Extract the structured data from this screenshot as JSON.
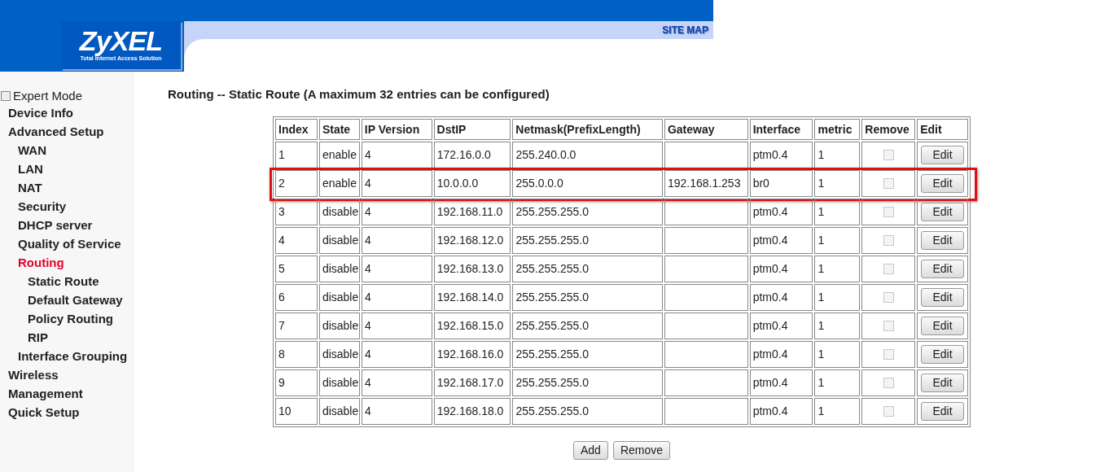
{
  "header": {
    "logo": "ZyXEL",
    "tagline": "Total Internet Access Solution",
    "site_map": "SITE MAP"
  },
  "sidebar": {
    "expert_mode": {
      "label": "Expert Mode",
      "checked": false
    },
    "items": [
      {
        "label": "Device Info",
        "selected": false
      },
      {
        "label": "Advanced Setup",
        "selected": false,
        "children": [
          {
            "label": "WAN",
            "selected": false
          },
          {
            "label": "LAN",
            "selected": false
          },
          {
            "label": "NAT",
            "selected": false
          },
          {
            "label": "Security",
            "selected": false
          },
          {
            "label": "DHCP server",
            "selected": false
          },
          {
            "label": "Quality of Service",
            "selected": false
          },
          {
            "label": "Routing",
            "selected": true,
            "children": [
              {
                "label": "Static Route",
                "selected": false
              },
              {
                "label": "Default Gateway",
                "selected": false
              },
              {
                "label": "Policy Routing",
                "selected": false
              },
              {
                "label": "RIP",
                "selected": false
              }
            ]
          },
          {
            "label": "Interface Grouping",
            "selected": false
          }
        ]
      },
      {
        "label": "Wireless",
        "selected": false
      },
      {
        "label": "Management",
        "selected": false
      },
      {
        "label": "Quick Setup",
        "selected": false
      }
    ]
  },
  "page_title": "Routing -- Static Route (A maximum 32 entries can be configured)",
  "table": {
    "columns": [
      "Index",
      "State",
      "IP Version",
      "DstIP",
      "Netmask(PrefixLength)",
      "Gateway",
      "Interface",
      "metric",
      "Remove",
      "Edit"
    ],
    "rows": [
      {
        "index": "1",
        "state": "enable",
        "ip_version": "4",
        "dst_ip": "172.16.0.0",
        "netmask": "255.240.0.0",
        "gateway": "",
        "interface": "ptm0.4",
        "metric": "1",
        "remove": false,
        "edit": "Edit",
        "highlighted": false
      },
      {
        "index": "2",
        "state": "enable",
        "ip_version": "4",
        "dst_ip": "10.0.0.0",
        "netmask": "255.0.0.0",
        "gateway": "192.168.1.253",
        "interface": "br0",
        "metric": "1",
        "remove": false,
        "edit": "Edit",
        "highlighted": true
      },
      {
        "index": "3",
        "state": "disable",
        "ip_version": "4",
        "dst_ip": "192.168.11.0",
        "netmask": "255.255.255.0",
        "gateway": "",
        "interface": "ptm0.4",
        "metric": "1",
        "remove": false,
        "edit": "Edit",
        "highlighted": false
      },
      {
        "index": "4",
        "state": "disable",
        "ip_version": "4",
        "dst_ip": "192.168.12.0",
        "netmask": "255.255.255.0",
        "gateway": "",
        "interface": "ptm0.4",
        "metric": "1",
        "remove": false,
        "edit": "Edit",
        "highlighted": false
      },
      {
        "index": "5",
        "state": "disable",
        "ip_version": "4",
        "dst_ip": "192.168.13.0",
        "netmask": "255.255.255.0",
        "gateway": "",
        "interface": "ptm0.4",
        "metric": "1",
        "remove": false,
        "edit": "Edit",
        "highlighted": false
      },
      {
        "index": "6",
        "state": "disable",
        "ip_version": "4",
        "dst_ip": "192.168.14.0",
        "netmask": "255.255.255.0",
        "gateway": "",
        "interface": "ptm0.4",
        "metric": "1",
        "remove": false,
        "edit": "Edit",
        "highlighted": false
      },
      {
        "index": "7",
        "state": "disable",
        "ip_version": "4",
        "dst_ip": "192.168.15.0",
        "netmask": "255.255.255.0",
        "gateway": "",
        "interface": "ptm0.4",
        "metric": "1",
        "remove": false,
        "edit": "Edit",
        "highlighted": false
      },
      {
        "index": "8",
        "state": "disable",
        "ip_version": "4",
        "dst_ip": "192.168.16.0",
        "netmask": "255.255.255.0",
        "gateway": "",
        "interface": "ptm0.4",
        "metric": "1",
        "remove": false,
        "edit": "Edit",
        "highlighted": false
      },
      {
        "index": "9",
        "state": "disable",
        "ip_version": "4",
        "dst_ip": "192.168.17.0",
        "netmask": "255.255.255.0",
        "gateway": "",
        "interface": "ptm0.4",
        "metric": "1",
        "remove": false,
        "edit": "Edit",
        "highlighted": false
      },
      {
        "index": "10",
        "state": "disable",
        "ip_version": "4",
        "dst_ip": "192.168.18.0",
        "netmask": "255.255.255.0",
        "gateway": "",
        "interface": "ptm0.4",
        "metric": "1",
        "remove": false,
        "edit": "Edit",
        "highlighted": false
      }
    ]
  },
  "buttons": [
    "Add",
    "Remove"
  ]
}
